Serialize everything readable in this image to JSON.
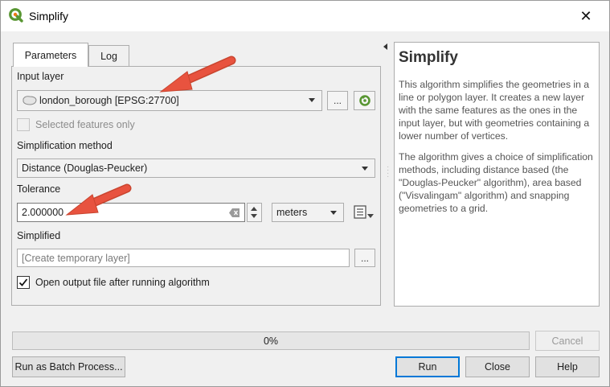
{
  "window": {
    "title": "Simplify",
    "close_glyph": "✕"
  },
  "tabs": [
    {
      "label": "Parameters"
    },
    {
      "label": "Log"
    }
  ],
  "input_layer": {
    "label": "Input layer",
    "value": "london_borough [EPSG:27700]",
    "browse_label": "..."
  },
  "selected_only": {
    "label": "Selected features only",
    "checked": false,
    "enabled": false
  },
  "method": {
    "label": "Simplification method",
    "value": "Distance (Douglas-Peucker)"
  },
  "tolerance": {
    "label": "Tolerance",
    "value": "2.000000",
    "unit": "meters"
  },
  "output": {
    "label": "Simplified",
    "placeholder": "[Create temporary layer]",
    "browse_label": "..."
  },
  "open_output": {
    "label": "Open output file after running algorithm",
    "checked": true
  },
  "help": {
    "title": "Simplify",
    "paragraphs": [
      "This algorithm simplifies the geometries in a line or polygon layer. It creates a new layer with the same features as the ones in the input layer, but with geometries containing a lower number of vertices.",
      "The algorithm gives a choice of simplification methods, including distance based (the \"Douglas-Peucker\" algorithm), area based (\"Visvalingam\" algorithm) and snapping geometries to a grid."
    ]
  },
  "progress": {
    "text": "0%",
    "value": 0
  },
  "buttons": {
    "cancel": "Cancel",
    "batch": "Run as Batch Process...",
    "run": "Run",
    "close": "Close",
    "help": "Help"
  },
  "colors": {
    "accent": "#0078d7",
    "annotation_arrow": "#e8533f",
    "qgis_green": "#589632"
  },
  "icons": {
    "app": "qgis-logo-icon",
    "layer": "polygon-layer-icon",
    "iterate": "iterate-green-icon",
    "clear": "clear-text-icon",
    "data_defined": "data-defined-override-icon"
  }
}
